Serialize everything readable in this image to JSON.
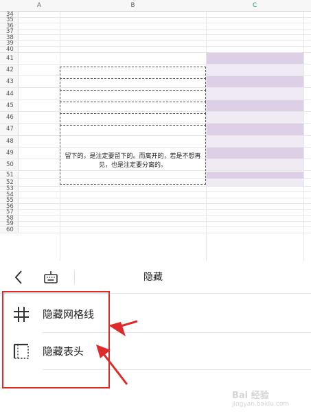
{
  "spreadsheet": {
    "columns": [
      "A",
      "B",
      "C"
    ],
    "selected_column": "C",
    "rows": [
      "34",
      "35",
      "36",
      "37",
      "38",
      "39",
      "40",
      "41",
      "42",
      "43",
      "44",
      "45",
      "46",
      "47",
      "48",
      "49",
      "50",
      "51",
      "52",
      "53",
      "54",
      "55",
      "56",
      "57",
      "58",
      "59",
      "60"
    ],
    "merged_cell_text": "留下的，是注定要留下的。而离开的，若是不想再见，也是注定要分离的。"
  },
  "toolbar": {
    "title": "隐藏",
    "back_icon": "chevron-left-icon",
    "keyboard_icon": "keyboard-icon"
  },
  "options": [
    {
      "label": "隐藏网格线",
      "icon": "grid-icon"
    },
    {
      "label": "隐藏表头",
      "icon": "header-icon"
    }
  ],
  "colors": {
    "annotation_red": "#e02a2a",
    "selection_purple_dark": "#ddd0e6",
    "selection_purple_light": "#f0eaf5",
    "selected_column_header": "#19a15f"
  },
  "watermark": {
    "brand": "Bai 经验",
    "url": "jingyan.baidu.com"
  }
}
